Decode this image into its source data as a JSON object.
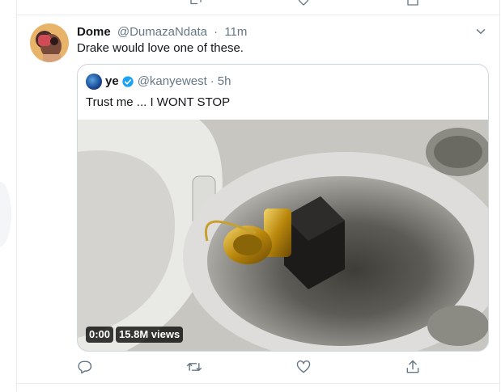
{
  "tweet": {
    "author_name": "Dome",
    "author_handle": "@DumazaNdata",
    "separator": "·",
    "time": "11m",
    "text": "Drake would love one of these."
  },
  "quoted_tweet": {
    "author_name": "ye",
    "author_handle": "@kanyewest",
    "separator": "·",
    "time": "5h",
    "text": "Trust me ... I WONT STOP",
    "verified": true
  },
  "video": {
    "duration": "0:00",
    "views": "15.8M views"
  },
  "icons": {
    "reply": "reply-icon",
    "retweet": "retweet-icon",
    "like": "heart-icon",
    "share": "share-icon",
    "caret": "chevron-down-icon",
    "verified": "verified-badge-icon"
  },
  "colors": {
    "icon": "#657786",
    "verified": "#1da1f2",
    "border": "#e6ecf0"
  }
}
